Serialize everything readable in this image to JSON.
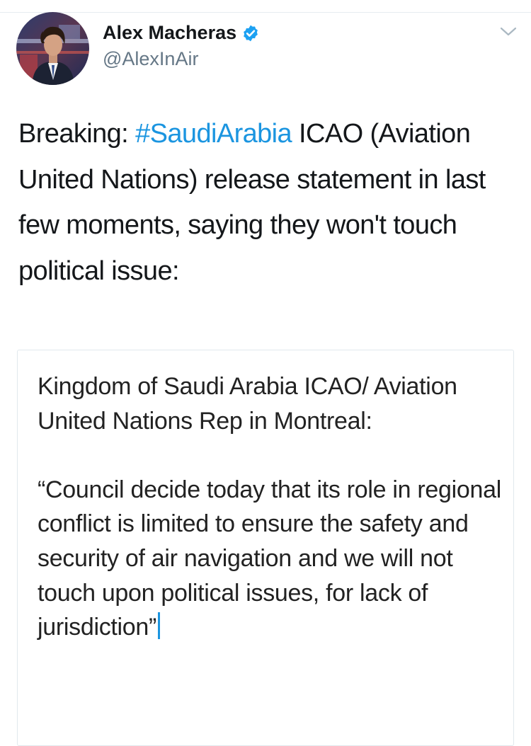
{
  "tweet": {
    "author": {
      "name": "Alex Macheras",
      "handle": "@AlexInAir",
      "verified": true,
      "avatar_icon": "profile-photo"
    },
    "menu_icon": "chevron-down-icon",
    "text": {
      "prefix": "Breaking: ",
      "hashtag": "#SaudiArabia",
      "suffix": " ICAO (Aviation United Nations) release statement in last few moments, saying they won't touch political issue:"
    },
    "image_card": {
      "paragraph_1": "Kingdom of Saudi Arabia ICAO/ Aviation United Nations Rep in Montreal:",
      "paragraph_2": "“Council decide today that its role in regional conflict is limited to ensure the safety and security of air navigation and we will not touch upon political issues, for lack of jurisdiction”"
    }
  },
  "colors": {
    "link": "#1b95e0",
    "text": "#14171a",
    "secondary_text": "#657786",
    "border": "#e1e8ed"
  }
}
